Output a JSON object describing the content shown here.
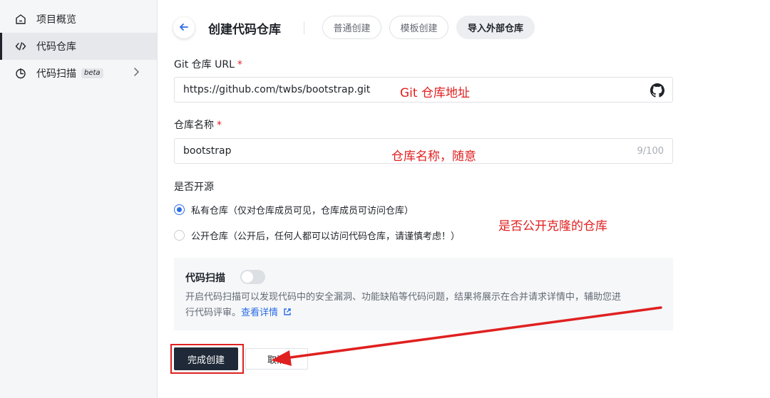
{
  "sidebar": {
    "items": [
      {
        "label": "项目概览",
        "icon": "home-icon"
      },
      {
        "label": "代码仓库",
        "icon": "code-icon",
        "active": true
      },
      {
        "label": "代码扫描",
        "icon": "scan-icon",
        "badge": "beta"
      }
    ]
  },
  "header": {
    "title": "创建代码仓库",
    "tabs": [
      {
        "label": "普通创建"
      },
      {
        "label": "模板创建"
      },
      {
        "label": "导入外部仓库",
        "active": true
      }
    ]
  },
  "form": {
    "git_url": {
      "label": "Git 仓库 URL",
      "required_mark": "*",
      "value": "https://github.com/twbs/bootstrap.git"
    },
    "repo_name": {
      "label": "仓库名称",
      "required_mark": "*",
      "value": "bootstrap",
      "counter": "9/100"
    },
    "visibility": {
      "label": "是否开源",
      "options": [
        {
          "label": "私有仓库（仅对仓库成员可见，仓库成员可访问仓库）",
          "checked": true
        },
        {
          "label": "公开仓库（公开后，任何人都可以访问代码仓库，请谨慎考虑！）",
          "checked": false
        }
      ]
    },
    "code_scan": {
      "title": "代码扫描",
      "enabled": false,
      "desc_line1": "开启代码扫描可以发现代码中的安全漏洞、功能缺陷等代码问题，结果将展示在合并请求详情中，辅助您进",
      "desc_line2": "行代码评审。",
      "link": "查看详情"
    },
    "submit_label": "完成创建",
    "cancel_label": "取消"
  },
  "annotations": {
    "git_url_note": "Git 仓库地址",
    "repo_name_note": "仓库名称，随意",
    "visibility_note": "是否公开克隆的仓库"
  },
  "colors": {
    "accent": "#2b6de5",
    "annotation": "#e02020",
    "primary_button": "#1f2937"
  }
}
